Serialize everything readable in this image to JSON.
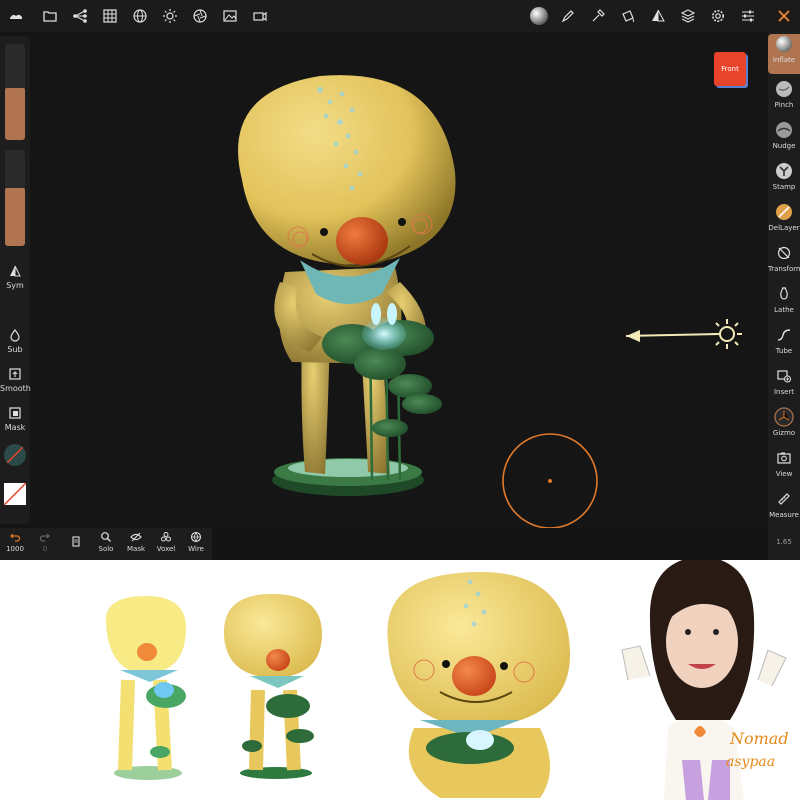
{
  "top_toolbar": {
    "icons": [
      "menu-logo-icon",
      "folder-icon",
      "scene-tree-icon",
      "grid-icon",
      "globe-icon",
      "sun-icon",
      "aperture-icon",
      "image-icon",
      "camera-icon",
      "material-sphere-icon",
      "brush-icon",
      "pipette-icon",
      "paint-cup-icon",
      "symmetry-icon",
      "layers-icon",
      "settings-gear-icon",
      "sliders-icon",
      "tools-cross-icon"
    ]
  },
  "left_panel": {
    "radius_slider_value": 0.55,
    "intensity_slider_value": 0.6,
    "sym_label": "Sym",
    "sub_label": "Sub",
    "smooth_label": "Smooth",
    "mask_label": "Mask"
  },
  "bottom_bar": {
    "undo_count": "1000",
    "redo_count": "0",
    "solo_label": "Solo",
    "mask_label": "Mask",
    "voxel_label": "Voxel",
    "wire_label": "Wire"
  },
  "right_tools": {
    "items": [
      {
        "label": "Inflate",
        "icon": "inflate-sphere-icon"
      },
      {
        "label": "Pinch",
        "icon": "pinch-sphere-icon"
      },
      {
        "label": "Nudge",
        "icon": "nudge-sphere-icon"
      },
      {
        "label": "Stamp",
        "icon": "stamp-sphere-icon"
      },
      {
        "label": "DelLayer",
        "icon": "dellayer-sphere-icon"
      },
      {
        "label": "Transform",
        "icon": "transform-icon"
      },
      {
        "label": "Lathe",
        "icon": "lathe-icon"
      },
      {
        "label": "Tube",
        "icon": "tube-icon"
      },
      {
        "label": "Insert",
        "icon": "insert-icon"
      },
      {
        "label": "Gizmo",
        "icon": "gizmo-icon"
      },
      {
        "label": "View",
        "icon": "view-camera-icon"
      },
      {
        "label": "Measure",
        "icon": "measure-ruler-icon"
      }
    ],
    "active": "Inflate"
  },
  "view_cube": {
    "label": "Front"
  },
  "version": "1.65",
  "colors": {
    "accent": "#b07550",
    "brush_ring": "#e07a2a",
    "character_yellow": "#e9c860",
    "nose_orange": "#e2551f",
    "leaf_green": "#2e6b3a",
    "cube_red": "#e8442b"
  },
  "bottom_illustration": {
    "handwriting_line1": "Nomad",
    "handwriting_line2": "asypaa"
  }
}
